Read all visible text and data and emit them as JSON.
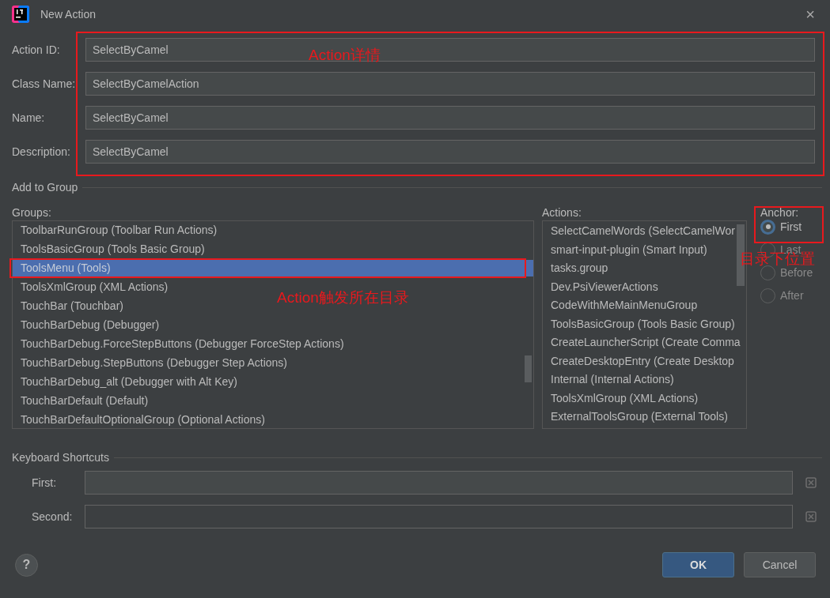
{
  "window": {
    "title": "New Action",
    "close": "×"
  },
  "fields": [
    {
      "label": "Action ID:",
      "value": "SelectByCamel"
    },
    {
      "label": "Class Name:",
      "value": "SelectByCamelAction"
    },
    {
      "label": "Name:",
      "value": "SelectByCamel"
    },
    {
      "label": "Description:",
      "value": "SelectByCamel"
    }
  ],
  "add_to_group": {
    "title": "Add to Group",
    "groups": {
      "label": "Groups:",
      "items": [
        {
          "text": "ToolbarRunGroup (Toolbar Run Actions)",
          "selected": false
        },
        {
          "text": "ToolsBasicGroup (Tools Basic Group)",
          "selected": false
        },
        {
          "text": "ToolsMenu (Tools)",
          "selected": true
        },
        {
          "text": "ToolsXmlGroup (XML Actions)",
          "selected": false
        },
        {
          "text": "TouchBar (Touchbar)",
          "selected": false
        },
        {
          "text": "TouchBarDebug (Debugger)",
          "selected": false
        },
        {
          "text": "TouchBarDebug.ForceStepButtons (Debugger ForceStep Actions)",
          "selected": false
        },
        {
          "text": "TouchBarDebug.StepButtons (Debugger Step Actions)",
          "selected": false
        },
        {
          "text": "TouchBarDebug_alt (Debugger with Alt Key)",
          "selected": false
        },
        {
          "text": "TouchBarDefault (Default)",
          "selected": false
        },
        {
          "text": "TouchBarDefaultOptionalGroup (Optional Actions)",
          "selected": false
        }
      ]
    },
    "actions": {
      "label": "Actions:",
      "items": [
        "SelectCamelWords (SelectCamelWor",
        "smart-input-plugin (Smart Input)",
        "tasks.group",
        "Dev.PsiViewerActions",
        "CodeWithMeMainMenuGroup",
        "ToolsBasicGroup (Tools Basic Group)",
        "CreateLauncherScript (Create Comma",
        "CreateDesktopEntry (Create Desktop",
        "Internal (Internal Actions)",
        "ToolsXmlGroup (XML Actions)",
        "ExternalToolsGroup (External Tools)"
      ]
    },
    "anchor": {
      "label": "Anchor:",
      "options": [
        {
          "label": "First",
          "selected": true
        },
        {
          "label": "Last",
          "selected": false
        },
        {
          "label": "Before",
          "selected": false
        },
        {
          "label": "After",
          "selected": false
        }
      ]
    }
  },
  "keyboard_shortcuts": {
    "title": "Keyboard Shortcuts",
    "fields": [
      {
        "label": "First:"
      },
      {
        "label": "Second:"
      }
    ]
  },
  "help": "?",
  "buttons": [
    {
      "label": "OK",
      "kind": "primary"
    },
    {
      "label": "Cancel",
      "kind": "secondary"
    }
  ],
  "annotations": [
    "Action详情",
    "Action触发所在目录",
    "目录下位置"
  ]
}
